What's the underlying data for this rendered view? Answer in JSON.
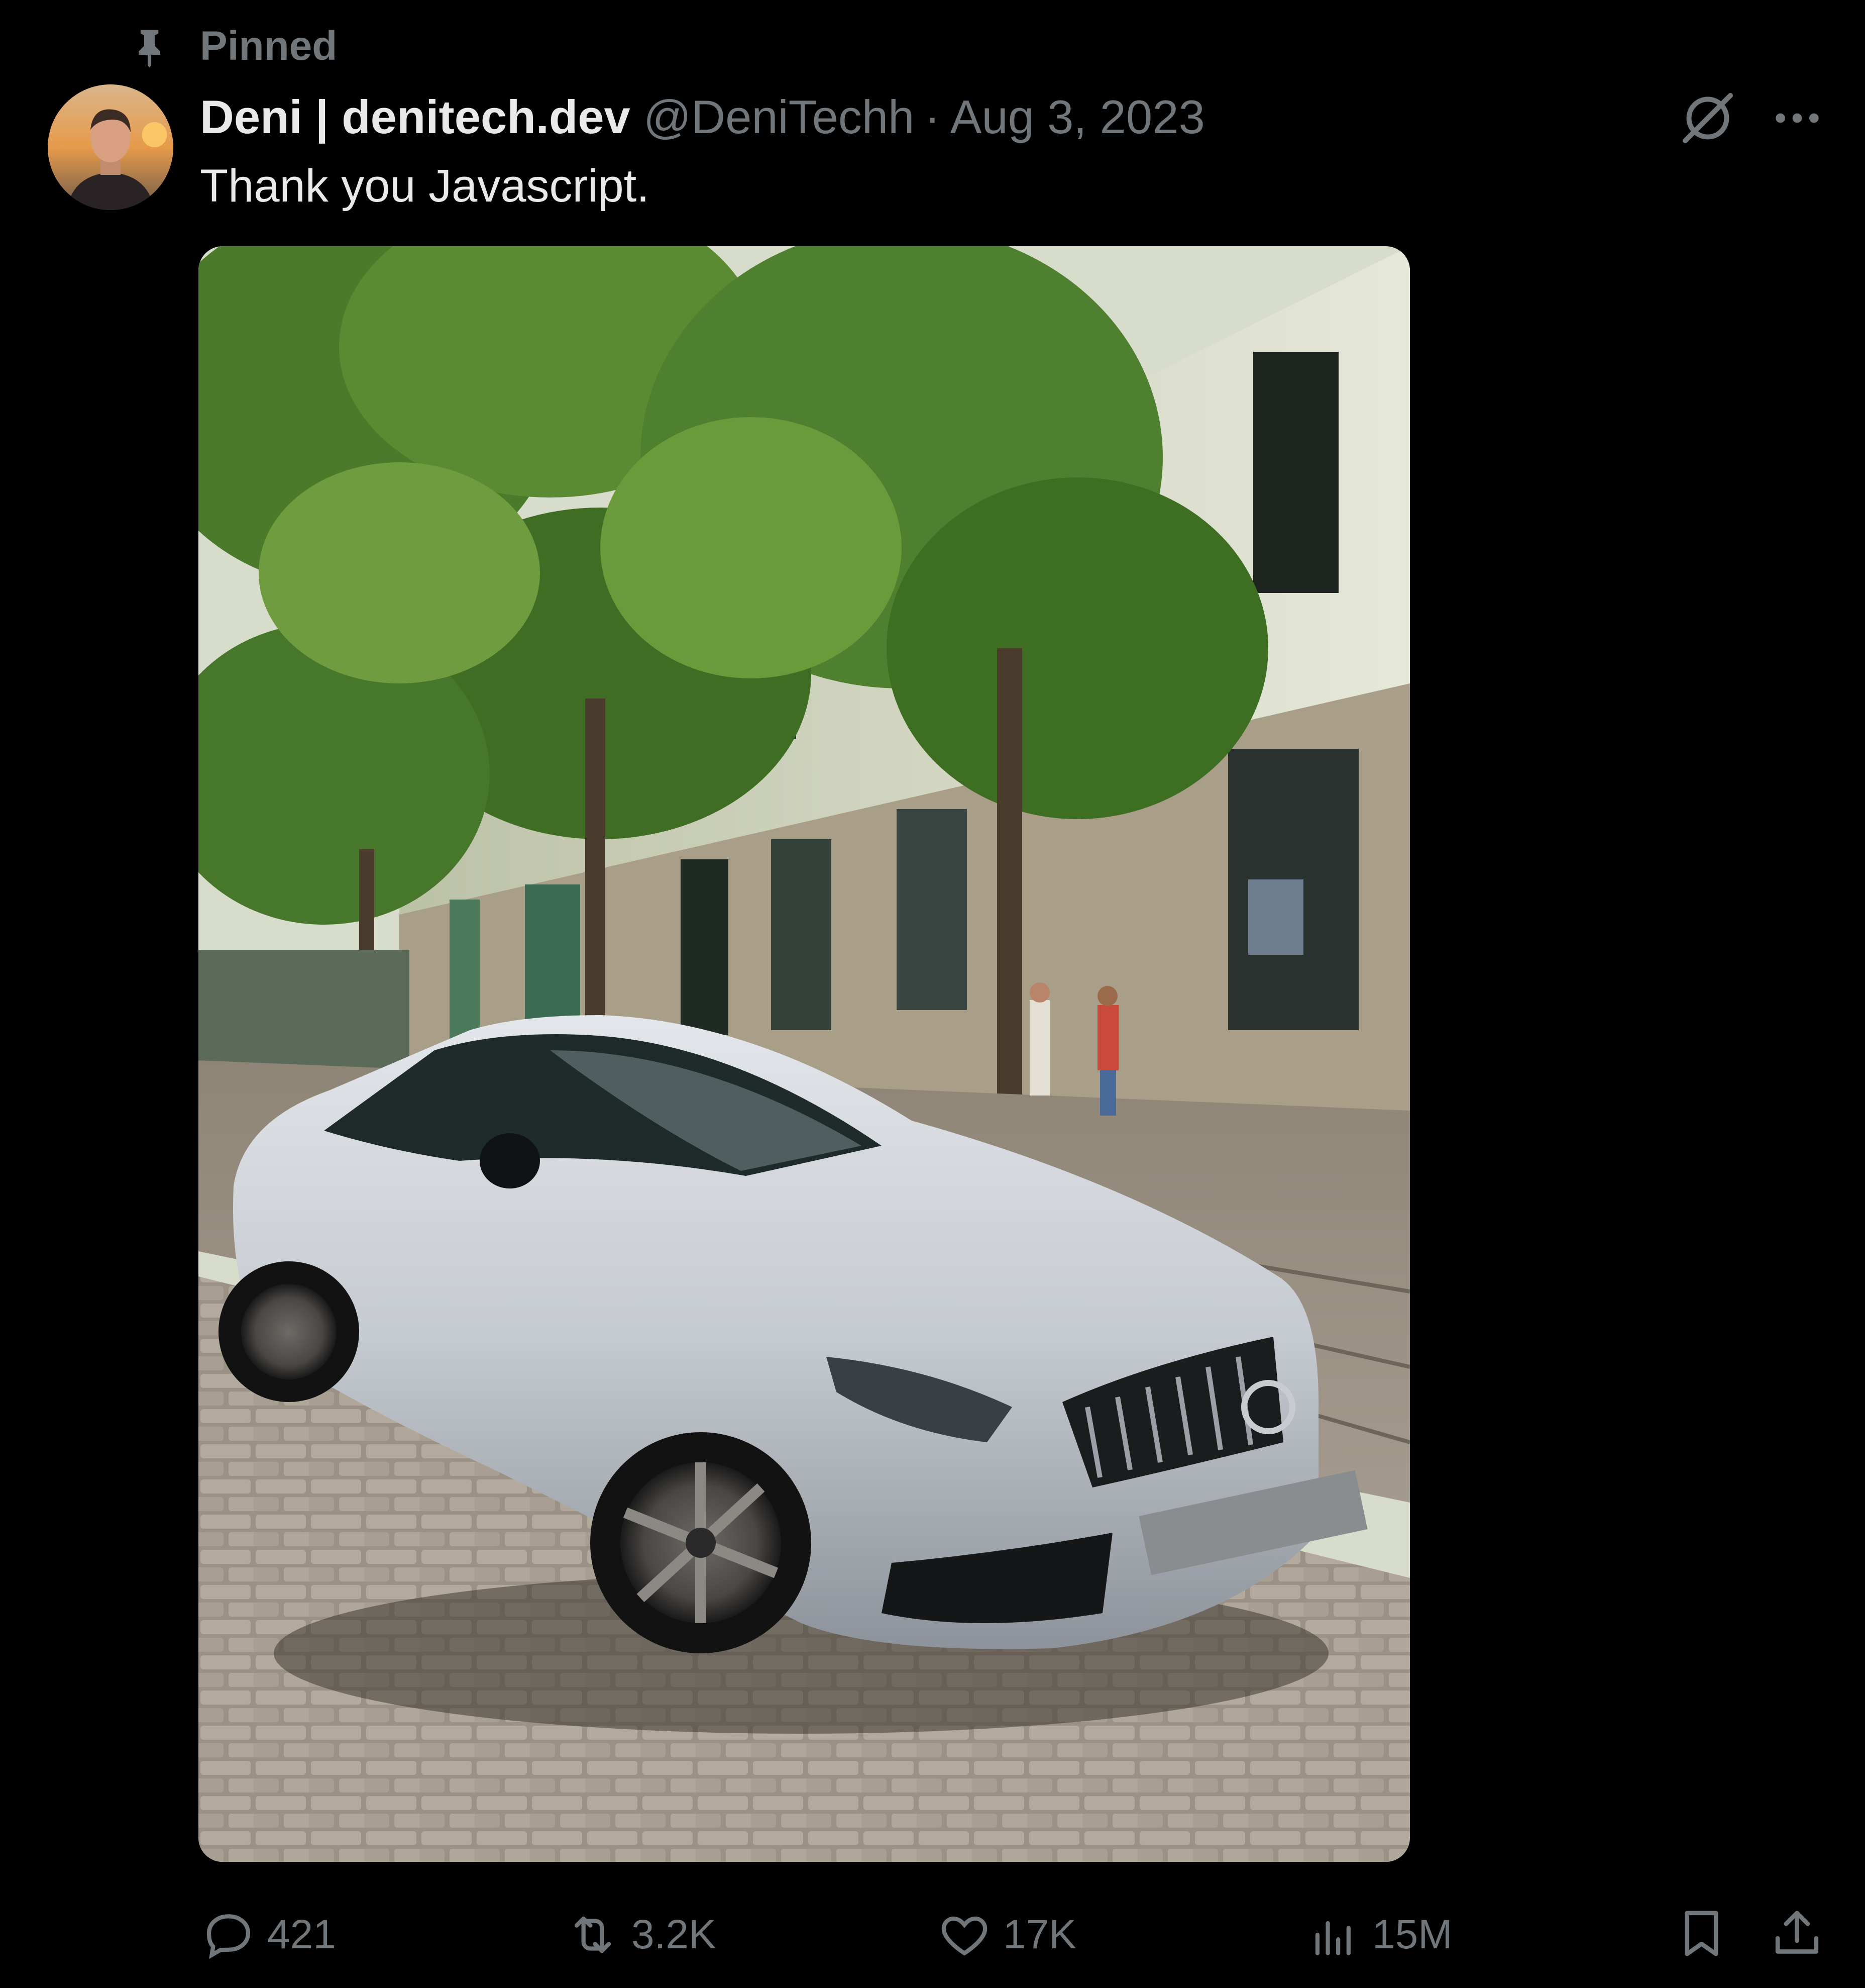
{
  "pinned": {
    "label": "Pinned",
    "icon": "pin-icon"
  },
  "author": {
    "display_name": "Deni | denitech.dev",
    "handle": "@DeniTechh",
    "separator": "·",
    "date": "Aug 3, 2023"
  },
  "tweet": {
    "text": "Thank you Javascript."
  },
  "header_icons": [
    "grok-icon",
    "more-icon"
  ],
  "media": {
    "kind": "photo"
  },
  "actions": {
    "reply": {
      "icon": "reply-icon",
      "count": "421"
    },
    "retweet": {
      "icon": "retweet-icon",
      "count": "3.2K"
    },
    "like": {
      "icon": "heart-icon",
      "count": "17K"
    },
    "views": {
      "icon": "views-icon",
      "count": "15M"
    },
    "bookmark": {
      "icon": "bookmark-icon"
    },
    "share": {
      "icon": "share-icon"
    }
  },
  "colors": {
    "background": "#000000",
    "text": "#e7e9ea",
    "muted": "#71767b"
  }
}
